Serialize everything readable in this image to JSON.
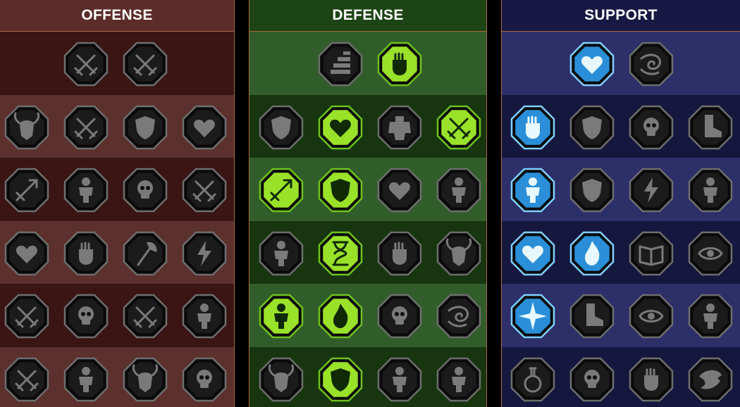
{
  "panels": [
    {
      "id": "offense",
      "title": "OFFENSE",
      "rows": [
        [
          {
            "icon": "crossed-swords-icon",
            "state": "inactive"
          },
          {
            "icon": "claw-slash-icon",
            "state": "inactive"
          }
        ],
        [
          {
            "icon": "demon-figure-icon",
            "state": "inactive"
          },
          {
            "icon": "sword-slash-icon",
            "state": "inactive"
          },
          {
            "icon": "shield-breaker-icon",
            "state": "inactive"
          },
          {
            "icon": "cursed-heart-icon",
            "state": "inactive"
          }
        ],
        [
          {
            "icon": "arrow-volley-icon",
            "state": "inactive"
          },
          {
            "icon": "fangs-icon",
            "state": "inactive"
          },
          {
            "icon": "skull-wind-icon",
            "state": "inactive"
          },
          {
            "icon": "reaper-blade-icon",
            "state": "inactive"
          }
        ],
        [
          {
            "icon": "dagger-heart-icon",
            "state": "inactive"
          },
          {
            "icon": "fist-strike-icon",
            "state": "inactive"
          },
          {
            "icon": "battle-axe-icon",
            "state": "inactive"
          },
          {
            "icon": "lightning-chain-icon",
            "state": "inactive"
          }
        ],
        [
          {
            "icon": "triple-blade-icon",
            "state": "inactive"
          },
          {
            "icon": "skulls-icon",
            "state": "inactive"
          },
          {
            "icon": "sword-ring-icon",
            "state": "inactive"
          },
          {
            "icon": "berserker-icon",
            "state": "inactive"
          }
        ],
        [
          {
            "icon": "sparkle-blade-icon",
            "state": "inactive"
          },
          {
            "icon": "flaming-helm-icon",
            "state": "inactive"
          },
          {
            "icon": "horned-demon-icon",
            "state": "inactive"
          },
          {
            "icon": "skull-burst-icon",
            "state": "inactive"
          }
        ]
      ]
    },
    {
      "id": "defense",
      "title": "DEFENSE",
      "rows": [
        [
          {
            "icon": "brick-wall-icon",
            "state": "inactive"
          },
          {
            "icon": "raised-fist-icon",
            "state": "active"
          }
        ],
        [
          {
            "icon": "chevron-shield-icon",
            "state": "inactive"
          },
          {
            "icon": "anatomical-heart-icon",
            "state": "active"
          },
          {
            "icon": "stone-golem-icon",
            "state": "inactive"
          },
          {
            "icon": "crossed-blades-icon",
            "state": "active"
          }
        ],
        [
          {
            "icon": "archer-dodge-icon",
            "state": "active"
          },
          {
            "icon": "knight-shield-icon",
            "state": "active"
          },
          {
            "icon": "dark-heart-icon",
            "state": "inactive"
          },
          {
            "icon": "hooded-head-icon",
            "state": "inactive"
          }
        ],
        [
          {
            "icon": "crowd-icon",
            "state": "inactive"
          },
          {
            "icon": "hourglass-icon",
            "state": "active"
          },
          {
            "icon": "open-hand-icon",
            "state": "inactive"
          },
          {
            "icon": "bull-head-icon",
            "state": "inactive"
          }
        ],
        [
          {
            "icon": "dash-runner-icon",
            "state": "active"
          },
          {
            "icon": "triple-flame-icon",
            "state": "active"
          },
          {
            "icon": "skull-sun-icon",
            "state": "inactive"
          },
          {
            "icon": "swirl-strike-icon",
            "state": "inactive"
          }
        ],
        [
          {
            "icon": "winged-beast-icon",
            "state": "inactive"
          },
          {
            "icon": "winged-shield-icon",
            "state": "active"
          },
          {
            "icon": "death-mask-icon",
            "state": "inactive"
          },
          {
            "icon": "flexing-figure-icon",
            "state": "inactive"
          }
        ]
      ]
    },
    {
      "id": "support",
      "title": "SUPPORT",
      "rows": [
        [
          {
            "icon": "healing-heart-icon",
            "state": "active"
          },
          {
            "icon": "spiral-wind-icon",
            "state": "inactive"
          }
        ],
        [
          {
            "icon": "praying-hands-icon",
            "state": "active"
          },
          {
            "icon": "aegis-shield-icon",
            "state": "inactive"
          },
          {
            "icon": "poison-skull-icon",
            "state": "inactive"
          },
          {
            "icon": "speeding-boot-icon",
            "state": "inactive"
          }
        ],
        [
          {
            "icon": "empowered-figure-icon",
            "state": "active"
          },
          {
            "icon": "lightning-shield-icon",
            "state": "inactive"
          },
          {
            "icon": "tremor-cracks-icon",
            "state": "inactive"
          },
          {
            "icon": "shadow-clone-icon",
            "state": "inactive"
          }
        ],
        [
          {
            "icon": "chained-heart-icon",
            "state": "active"
          },
          {
            "icon": "meteor-icon",
            "state": "active"
          },
          {
            "icon": "open-book-icon",
            "state": "inactive"
          },
          {
            "icon": "angry-eyes-icon",
            "state": "inactive"
          }
        ],
        [
          {
            "icon": "compass-star-icon",
            "state": "active"
          },
          {
            "icon": "swift-boot-icon",
            "state": "inactive"
          },
          {
            "icon": "all-seeing-eye-icon",
            "state": "inactive"
          },
          {
            "icon": "martial-stance-icon",
            "state": "inactive"
          }
        ],
        [
          {
            "icon": "potion-flask-icon",
            "state": "inactive"
          },
          {
            "icon": "grim-skull-icon",
            "state": "inactive"
          },
          {
            "icon": "chained-fist-icon",
            "state": "inactive"
          },
          {
            "icon": "eagle-head-icon",
            "state": "inactive"
          }
        ]
      ]
    }
  ],
  "colors": {
    "inactive_fill": "#1b1b1b",
    "inactive_border": "#6e6e6e",
    "inactive_icon": "#7a7a7a",
    "defense_active_fill": "#9ae22a",
    "defense_active_border": "#6fc21c",
    "defense_active_icon": "#0f2a05",
    "support_active_fill": "#2a8fd8",
    "support_active_border": "#7fd0ff",
    "support_active_icon": "#e8f8ff",
    "frame_accent": "#a86a3c"
  }
}
